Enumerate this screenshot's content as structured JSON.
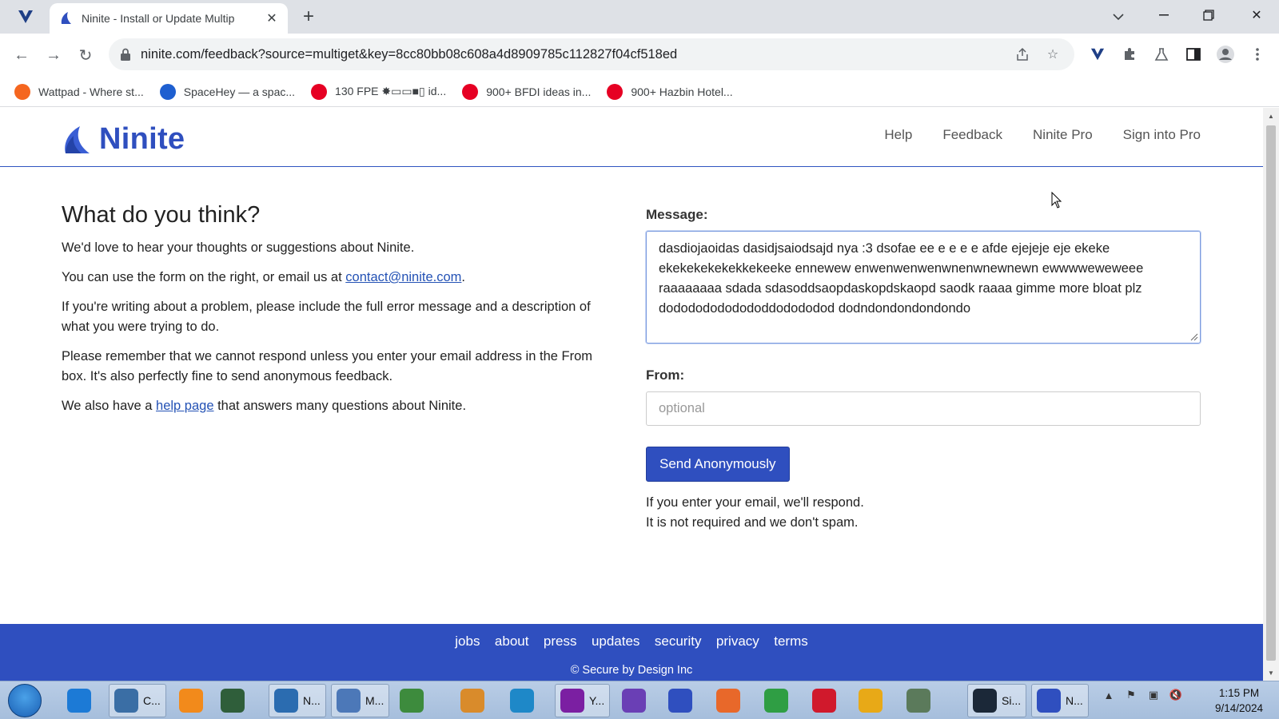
{
  "browser": {
    "tab_title": "Ninite - Install or Update Multip",
    "url": "ninite.com/feedback?source=multiget&key=8cc80bb08c608a4d8909785c112827f04cf518ed",
    "bookmarks": [
      {
        "label": "Wattpad - Where st...",
        "icon": "wattpad-icon",
        "color": "#f5661f"
      },
      {
        "label": "SpaceHey — a spac...",
        "icon": "spacehey-icon",
        "color": "#1e5fd0"
      },
      {
        "label": "130 FPE ✸▭▭■▯ id...",
        "icon": "pinterest-icon",
        "color": "#e60023"
      },
      {
        "label": "900+ BFDI ideas in...",
        "icon": "pinterest-icon",
        "color": "#e60023"
      },
      {
        "label": "900+ Hazbin Hotel...",
        "icon": "pinterest-icon",
        "color": "#e60023"
      }
    ]
  },
  "site": {
    "logo_text": "Ninite",
    "nav": [
      "Help",
      "Feedback",
      "Ninite Pro",
      "Sign into Pro"
    ],
    "brand_color": "#2f4fbf"
  },
  "content": {
    "heading": "What do you think?",
    "p1": "We'd love to hear your thoughts or suggestions about Ninite.",
    "p2_pre": "You can use the form on the right, or email us at ",
    "p2_link": "contact@ninite.com",
    "p2_post": ".",
    "p3": "If you're writing about a problem, please include the full error message and a description of what you were trying to do.",
    "p4": "Please remember that we cannot respond unless you enter your email address in the From box. It's also perfectly fine to send anonymous feedback.",
    "p5_pre": "We also have a ",
    "p5_link": "help page",
    "p5_post": " that answers many questions about Ninite."
  },
  "form": {
    "message_label": "Message:",
    "message_value": "dasdiojaoidas dasidjsaiodsajd nya :3 dsofae ee e e e e afde ejejeje eje ekeke ekekekekekekkekeeke ennewew enwenwenwenwnenwnewnewn ewwwweweweee raaaaaaaa sdada sdasoddsaopdaskopdskaopd saodk raaaa gimme more bloat plz dodododododododdodododod dodndondondondondo",
    "from_label": "From:",
    "from_placeholder": "optional",
    "send_label": "Send Anonymously",
    "note_line1": "If you enter your email, we'll respond.",
    "note_line2": "It is not required and we don't spam."
  },
  "footer": {
    "links": [
      "jobs",
      "about",
      "press",
      "updates",
      "security",
      "privacy",
      "terms"
    ],
    "copyright": "© Secure by Design Inc"
  },
  "taskbar": {
    "items": [
      {
        "label": "",
        "icon": "ie-icon",
        "color": "#1c7ad6"
      },
      {
        "label": "C...",
        "icon": "computer-icon",
        "color": "#3a6ea5"
      },
      {
        "label": "",
        "icon": "media-player-icon",
        "color": "#f28a1b"
      },
      {
        "label": "",
        "icon": "terminal-icon",
        "color": "#2f5e3a"
      },
      {
        "label": "N...",
        "icon": "globe-icon",
        "color": "#2b6cb0"
      },
      {
        "label": "M...",
        "icon": "building-icon",
        "color": "#4c78b8"
      },
      {
        "label": "",
        "icon": "users-icon",
        "color": "#3d8b3d"
      },
      {
        "label": "",
        "icon": "paint-icon",
        "color": "#d98b2b"
      },
      {
        "label": "",
        "icon": "edge-icon",
        "color": "#1e88c8"
      },
      {
        "label": "Y...",
        "icon": "yahoo-messenger-icon",
        "color": "#7b1fa2"
      },
      {
        "label": "",
        "icon": "visual-studio-icon",
        "color": "#6a3fb5"
      },
      {
        "label": "",
        "icon": "ninite-icon",
        "color": "#2f4fbf"
      },
      {
        "label": "",
        "icon": "firefox-icon",
        "color": "#e8682a"
      },
      {
        "label": "",
        "icon": "chrome-icon",
        "color": "#2f9e44"
      },
      {
        "label": "",
        "icon": "opera-icon",
        "color": "#d0192c"
      },
      {
        "label": "",
        "icon": "ring-icon",
        "color": "#e8a917"
      },
      {
        "label": "",
        "icon": "network-icon",
        "color": "#5b7a5b"
      },
      {
        "label": "Si...",
        "icon": "steam-icon",
        "color": "#1b2838"
      },
      {
        "label": "N...",
        "icon": "ninite-icon",
        "color": "#2f4fbf"
      }
    ],
    "time": "1:15 PM",
    "date": "9/14/2024"
  }
}
